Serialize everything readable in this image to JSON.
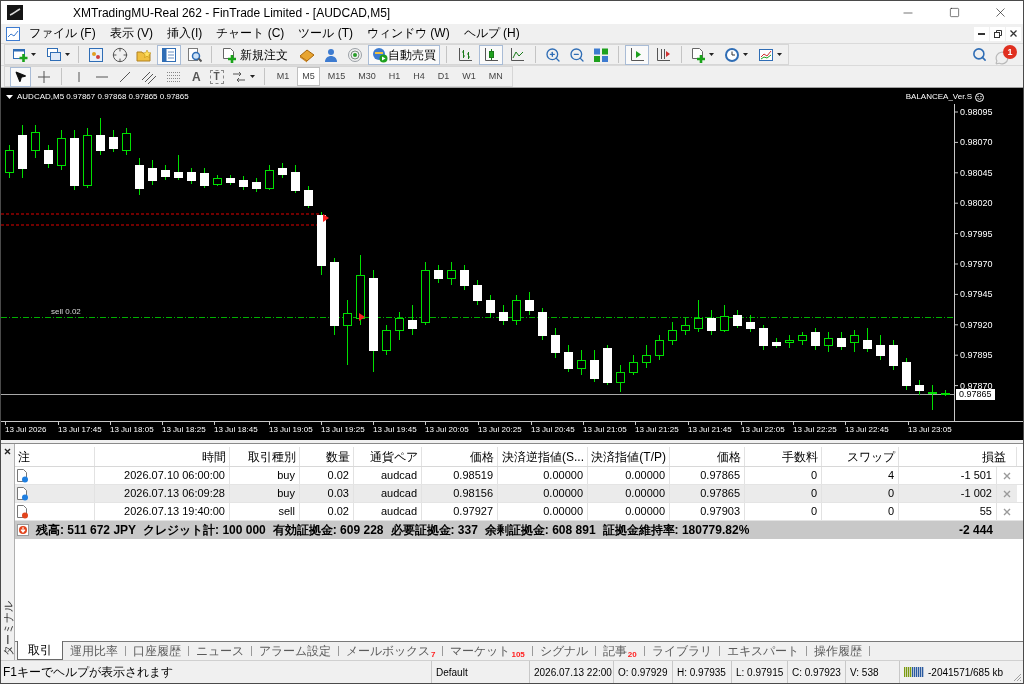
{
  "window": {
    "title": "XMTradingMU-Real 262 - FinTrade Limited - [AUDCAD,M5]"
  },
  "menu": [
    "ファイル (F)",
    "表示 (V)",
    "挿入(I)",
    "チャート (C)",
    "ツール (T)",
    "ウィンドウ (W)",
    "ヘルプ (H)"
  ],
  "toolbar": {
    "terminal_on": true,
    "new_order": "新規注文",
    "auto_trading": {
      "label": "自動売買",
      "on": true
    },
    "chart_types": [
      {
        "selected": false
      },
      {
        "selected": true
      },
      {
        "selected": false
      }
    ],
    "autoscroll_on": true,
    "chart_shift_on": false,
    "notifications": "1"
  },
  "drawing_tools": {
    "cursor_selected": true,
    "text_tool": "A",
    "label_tool": "T"
  },
  "timeframes": [
    {
      "label": "M1",
      "selected": false
    },
    {
      "label": "M5",
      "selected": true
    },
    {
      "label": "M15",
      "selected": false
    },
    {
      "label": "M30",
      "selected": false
    },
    {
      "label": "H1",
      "selected": false
    },
    {
      "label": "H4",
      "selected": false
    },
    {
      "label": "D1",
      "selected": false
    },
    {
      "label": "W1",
      "selected": false
    },
    {
      "label": "MN",
      "selected": false
    }
  ],
  "chart": {
    "header": "AUDCAD,M5 0.97867 0.97868 0.97865 0.97865",
    "expert": "BALANCEA_Ver.S",
    "price_labels": [
      "0.98095",
      "0.98070",
      "0.98045",
      "0.98020",
      "0.97995",
      "0.97970",
      "0.97945",
      "0.97920",
      "0.97895",
      "0.97870"
    ],
    "current_price": "0.97865",
    "time_labels": [
      "13 Jul 2026",
      "13 Jul 17:45",
      "13 Jul 18:05",
      "13 Jul 18:25",
      "13 Jul 18:45",
      "13 Jul 19:05",
      "13 Jul 19:25",
      "13 Jul 19:45",
      "13 Jul 20:05",
      "13 Jul 20:25",
      "13 Jul 20:45",
      "13 Jul 21:05",
      "13 Jul 21:25",
      "13 Jul 21:45",
      "13 Jul 22:05",
      "13 Jul 22:25",
      "13 Jul 22:45",
      "13 Jul 23:05"
    ],
    "order_line": "sell 0.02"
  },
  "terminal": {
    "title": "ターミナル",
    "columns": [
      "注",
      "時間",
      "取引種別",
      "数量",
      "通貨ペア",
      "価格",
      "決済逆指値(S...",
      "決済指値(T/P)",
      "価格",
      "手数料",
      "スワップ",
      "損益"
    ],
    "rows": [
      {
        "kind": "buy",
        "cells": [
          "",
          "2026.07.10 06:00:00",
          "buy",
          "0.02",
          "audcad",
          "0.98519",
          "0.00000",
          "0.00000",
          "0.97865",
          "0",
          "4",
          "-1 501"
        ]
      },
      {
        "kind": "buy",
        "cells": [
          "",
          "2026.07.13 06:09:28",
          "buy",
          "0.03",
          "audcad",
          "0.98156",
          "0.00000",
          "0.00000",
          "0.97865",
          "0",
          "0",
          "-1 002"
        ]
      },
      {
        "kind": "sell",
        "cells": [
          "",
          "2026.07.13 19:40:00",
          "sell",
          "0.02",
          "audcad",
          "0.97927",
          "0.00000",
          "0.00000",
          "0.97903",
          "0",
          "0",
          "55"
        ]
      }
    ],
    "summary": {
      "items": [
        "残高: 511 672 JPY",
        "クレジット計: 100 000",
        "有効証拠金: 609 228",
        "必要証拠金: 337",
        "余剰証拠金: 608 891",
        "証拠金維持率: 180779.82%"
      ],
      "profit": "-2 444"
    },
    "tabs": [
      {
        "label": "取引",
        "selected": true
      },
      {
        "label": "運用比率",
        "selected": false
      },
      {
        "label": "口座履歴",
        "selected": false
      },
      {
        "label": "ニュース",
        "selected": false
      },
      {
        "label": "アラーム設定",
        "selected": false
      },
      {
        "label": "メールボックス",
        "badge": "7",
        "selected": false
      },
      {
        "label": "マーケット",
        "badge": "105",
        "selected": false
      },
      {
        "label": "シグナル",
        "selected": false
      },
      {
        "label": "記事",
        "badge": "20",
        "selected": false
      },
      {
        "label": "ライブラリ",
        "selected": false
      },
      {
        "label": "エキスパート",
        "selected": false
      },
      {
        "label": "操作履歴",
        "selected": false
      }
    ]
  },
  "status_bar": {
    "hint": "F1キーでヘルプが表示されます",
    "profile": "Default",
    "bar_time": "2026.07.13 22:00",
    "ohlcv": [
      "O: 0.97929",
      "H: 0.97935",
      "L: 0.97915",
      "C: 0.97923",
      "V: 538"
    ],
    "traffic": "-2041571/685 kb"
  }
}
